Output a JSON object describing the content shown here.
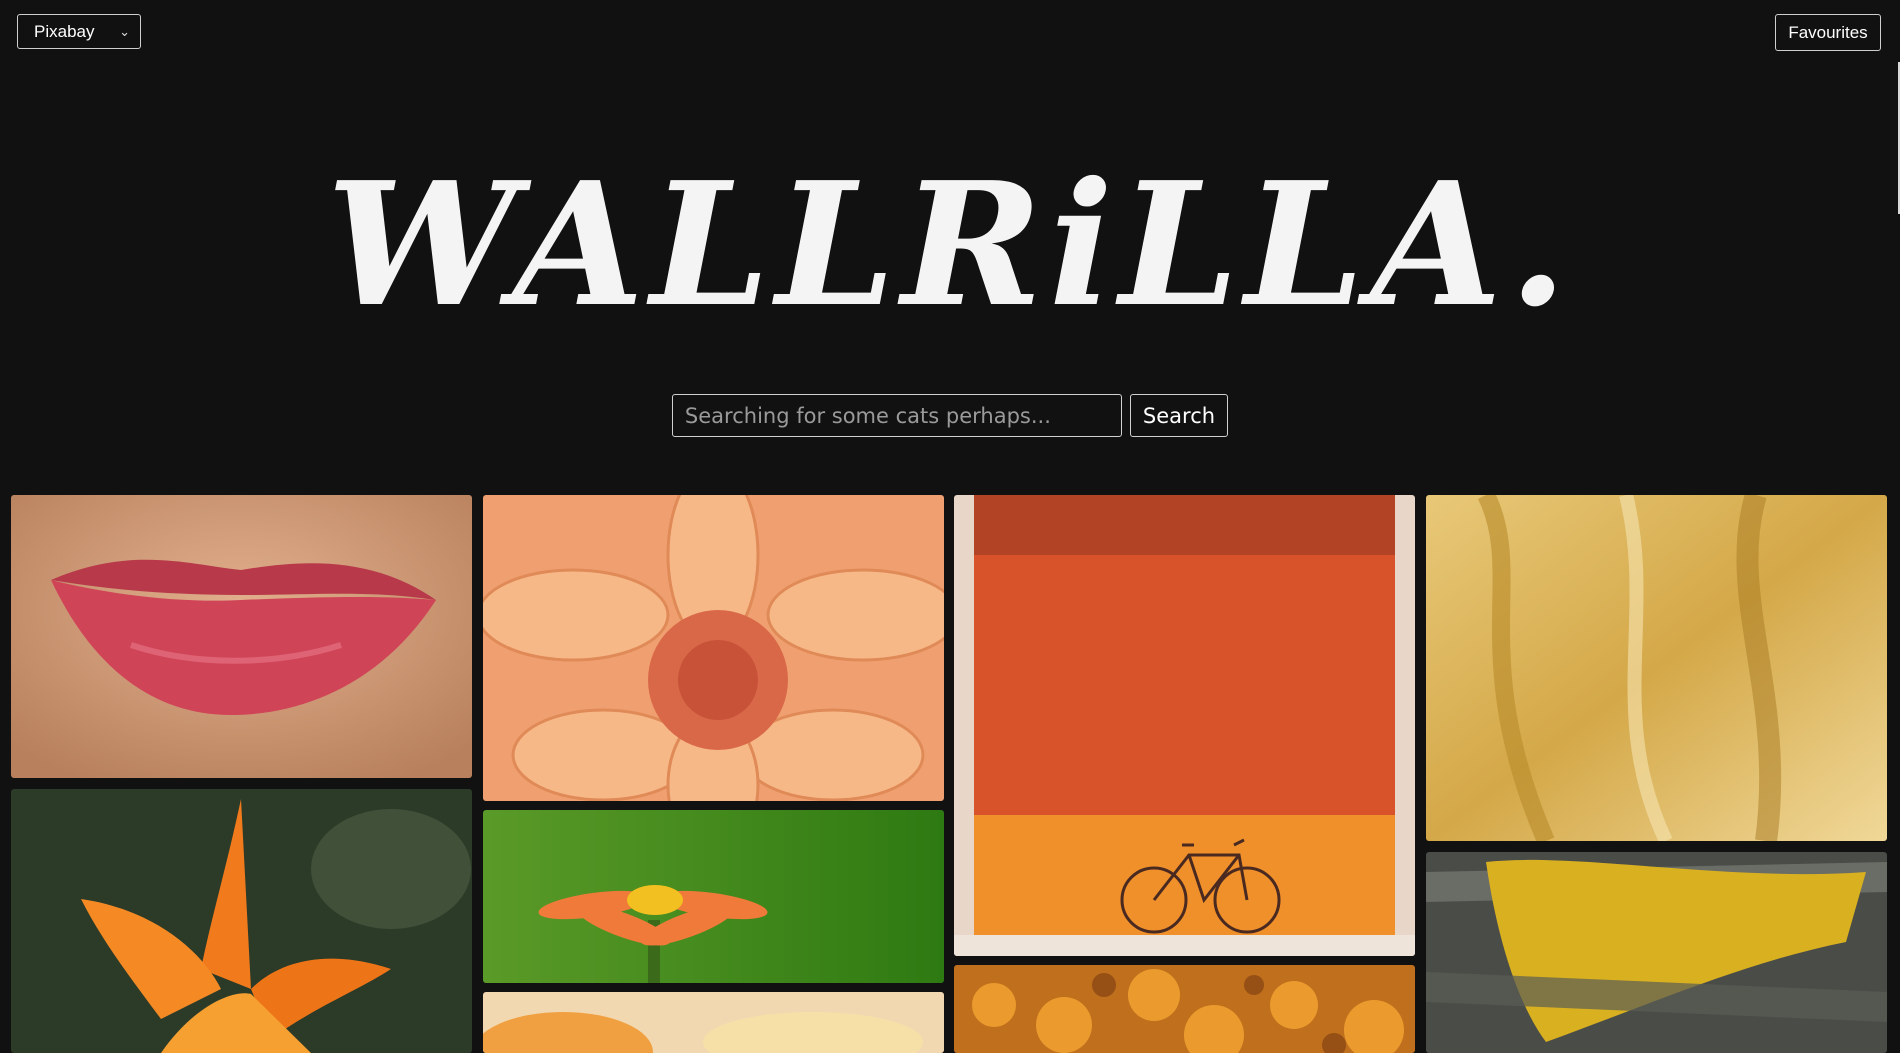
{
  "header": {
    "source_select": {
      "selected": "Pixabay"
    },
    "favourites_label": "Favourites"
  },
  "logo_text": "WALLRiLLA.",
  "search": {
    "placeholder": "Searching for some cats perhaps...",
    "value": "",
    "button_label": "Search"
  },
  "gallery": {
    "images": [
      {
        "subject": "red lips close-up"
      },
      {
        "subject": "orange dahlia flower"
      },
      {
        "subject": "bicycle against orange wall"
      },
      {
        "subject": "golden fabric texture"
      },
      {
        "subject": "orange lily flower"
      },
      {
        "subject": "orange zinnia on green"
      },
      {
        "subject": "yellow lichen on bark"
      },
      {
        "subject": "orange slices"
      },
      {
        "subject": "amber beads"
      }
    ]
  },
  "colors": {
    "background": "#111111",
    "text": "#f2f2f2",
    "border": "#d0d0d0"
  }
}
